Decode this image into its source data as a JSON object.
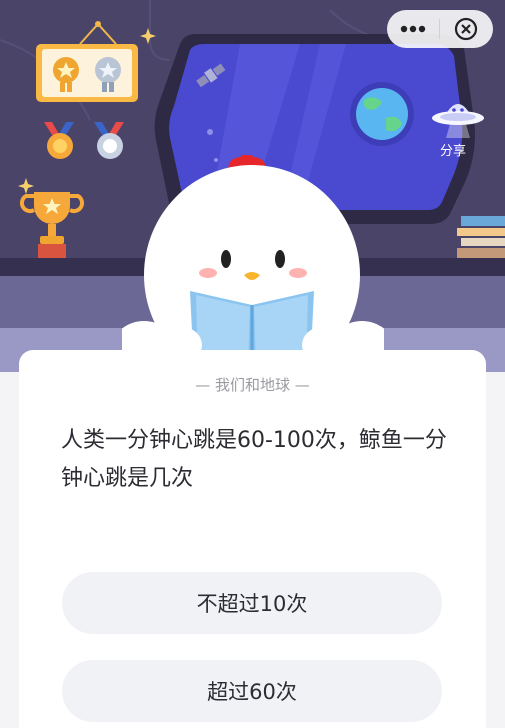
{
  "header": {
    "more_icon": "more-dots-icon",
    "close_icon": "close-circle-icon",
    "share_label": "分享"
  },
  "quiz": {
    "category": "— 我们和地球 —",
    "question": "人类一分钟心跳是60-100次，鲸鱼一分钟心跳是几次",
    "options": [
      {
        "label": "不超过10次"
      },
      {
        "label": "超过60次"
      }
    ]
  },
  "colors": {
    "scene_bg": "#4a4468",
    "window_blue": "#4a4ad0",
    "card_bg": "#ffffff",
    "option_bg": "#f1f2f5",
    "text_dark": "#2c2c33",
    "text_muted": "#9a9aa2"
  }
}
